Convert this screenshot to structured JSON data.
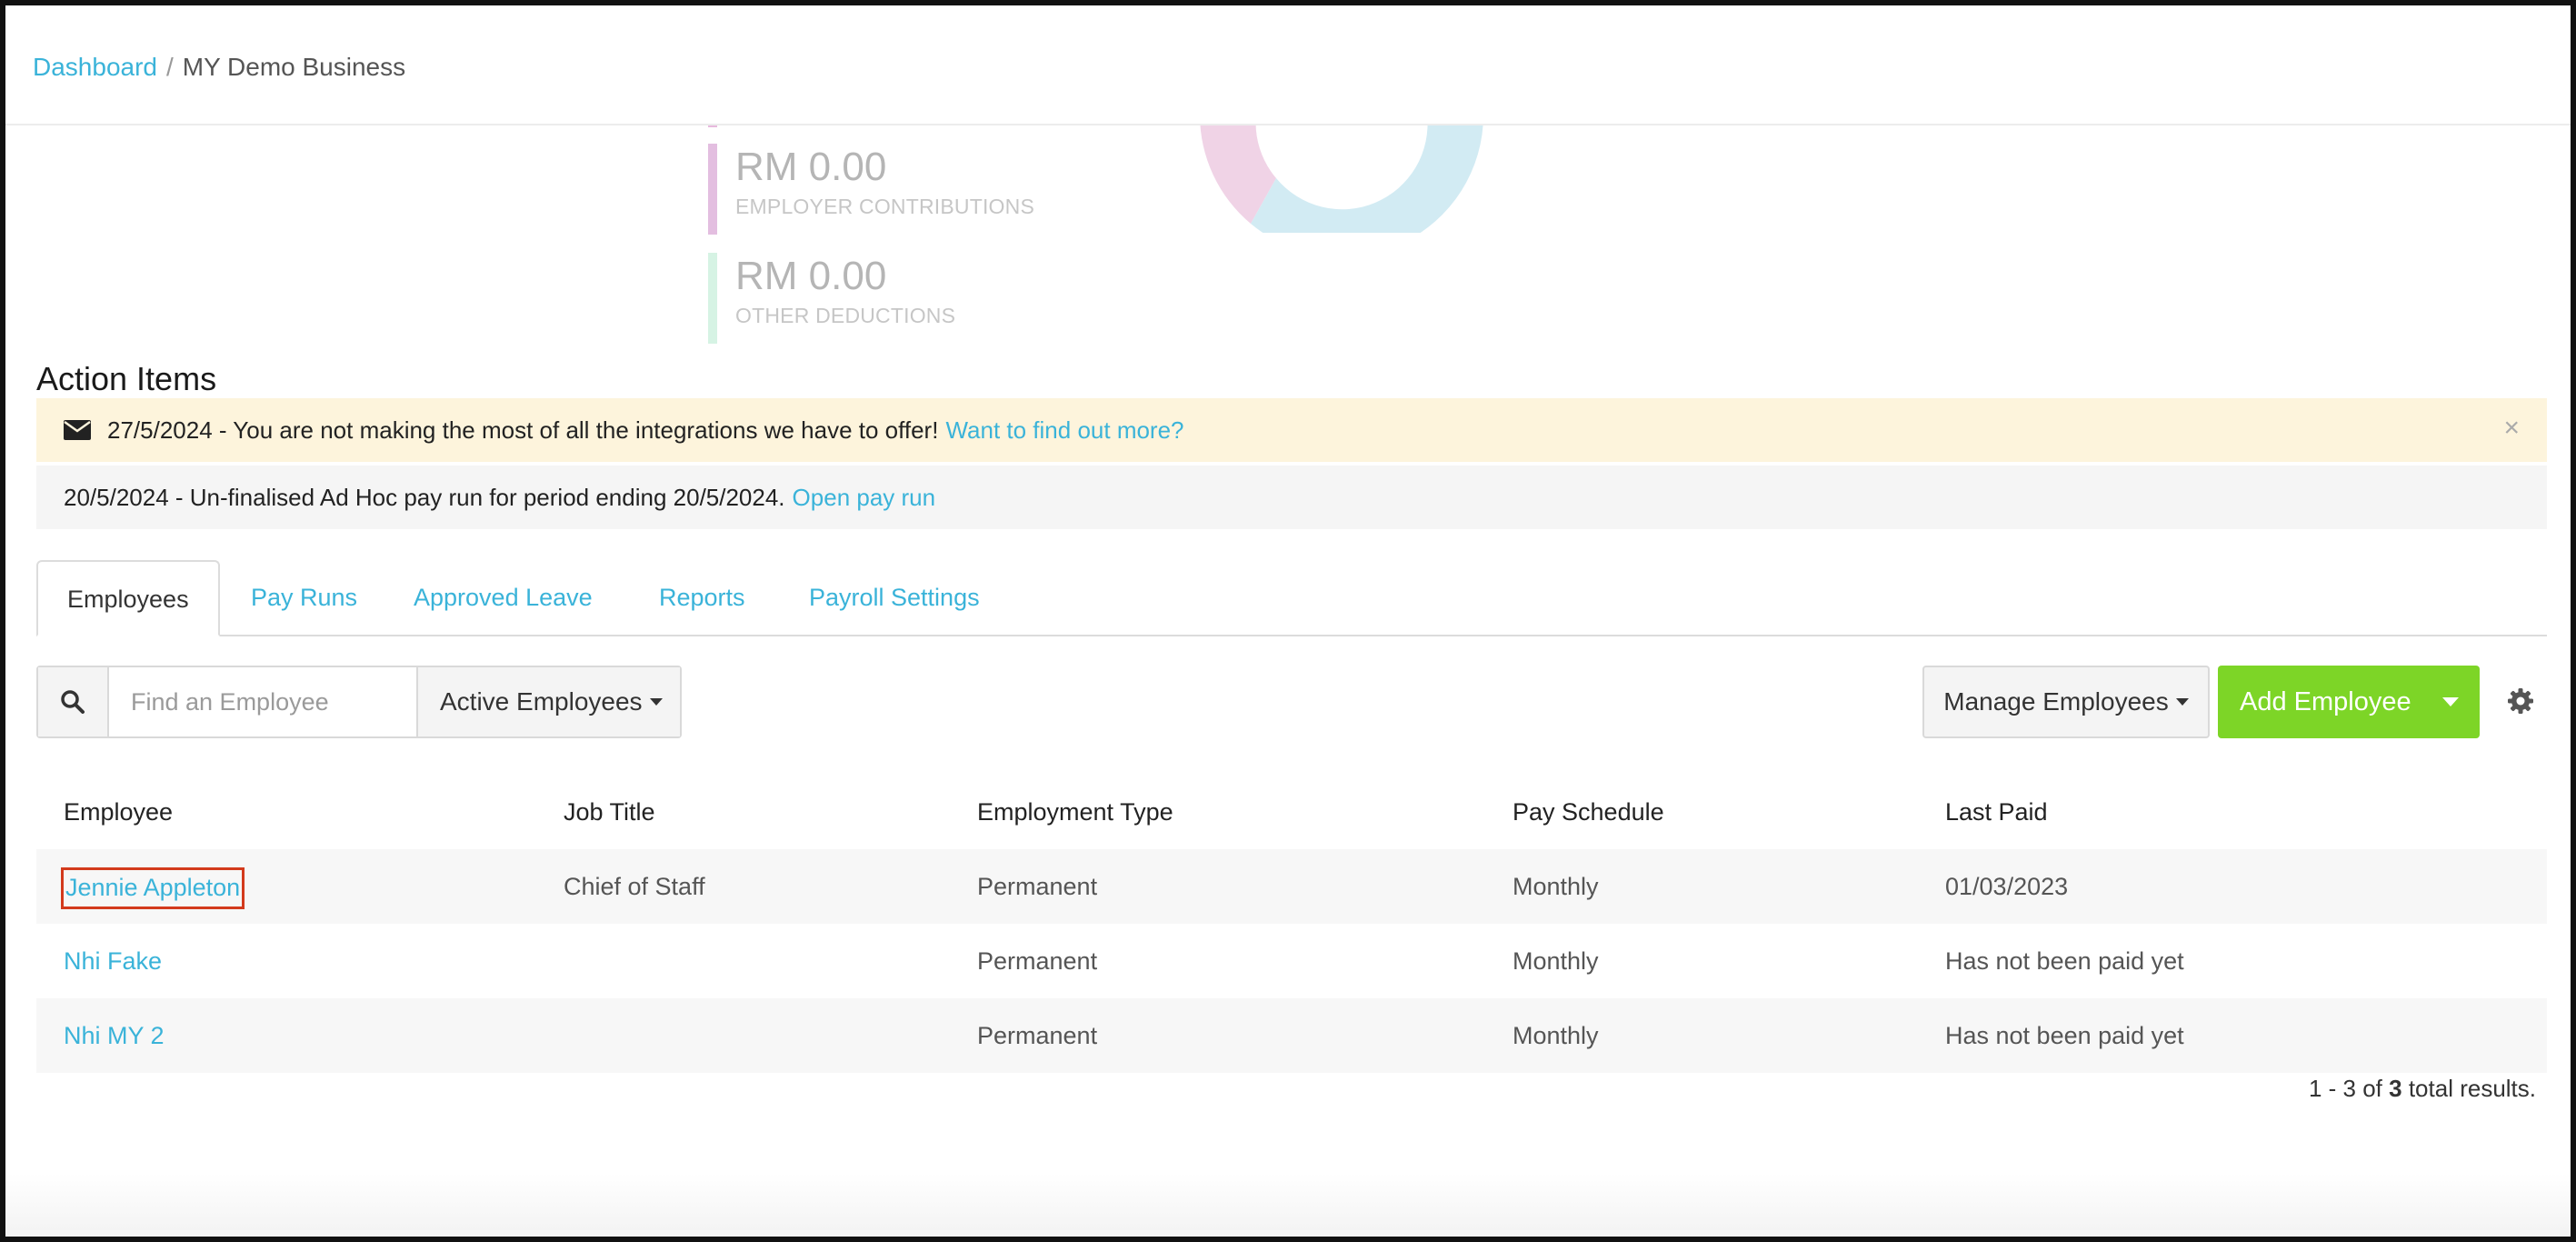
{
  "breadcrumb": {
    "root": "Dashboard",
    "separator": "/",
    "current": "MY Demo Business"
  },
  "summary": {
    "employer_contributions": {
      "amount": "RM 0.00",
      "label": "EMPLOYER CONTRIBUTIONS"
    },
    "other_deductions": {
      "amount": "RM 0.00",
      "label": "OTHER DEDUCTIONS"
    }
  },
  "action_items": {
    "title": "Action Items",
    "items": [
      {
        "text": "27/5/2024 - You are not making the most of all the integrations we have to offer!",
        "link": "Want to find out more?",
        "icon": "envelope-icon",
        "dismiss": "×"
      },
      {
        "text": "20/5/2024 - Un-finalised Ad Hoc pay run for period ending 20/5/2024.",
        "link": "Open pay run"
      }
    ]
  },
  "tabs": [
    {
      "label": "Employees",
      "active": true
    },
    {
      "label": "Pay Runs"
    },
    {
      "label": "Approved Leave"
    },
    {
      "label": "Reports"
    },
    {
      "label": "Payroll Settings"
    }
  ],
  "toolbar": {
    "search_placeholder": "Find an Employee",
    "filter_label": "Active Employees",
    "manage_label": "Manage Employees",
    "add_label": "Add Employee"
  },
  "table": {
    "columns": [
      "Employee",
      "Job Title",
      "Employment Type",
      "Pay Schedule",
      "Last Paid"
    ],
    "rows": [
      {
        "employee": "Jennie Appleton",
        "job_title": "Chief of Staff",
        "employment_type": "Permanent",
        "pay_schedule": "Monthly",
        "last_paid": "01/03/2023"
      },
      {
        "employee": "Nhi Fake",
        "job_title": "",
        "employment_type": "Permanent",
        "pay_schedule": "Monthly",
        "last_paid": "Has not been paid yet"
      },
      {
        "employee": "Nhi MY 2",
        "job_title": "",
        "employment_type": "Permanent",
        "pay_schedule": "Monthly",
        "last_paid": "Has not been paid yet"
      }
    ]
  },
  "results": {
    "prefix": "1 - 3 of",
    "count": "3",
    "suffix": "total results."
  },
  "colors": {
    "accent": "#3ab3d9",
    "add_button": "#7dd527",
    "warning_bg": "#fdf4dc"
  }
}
